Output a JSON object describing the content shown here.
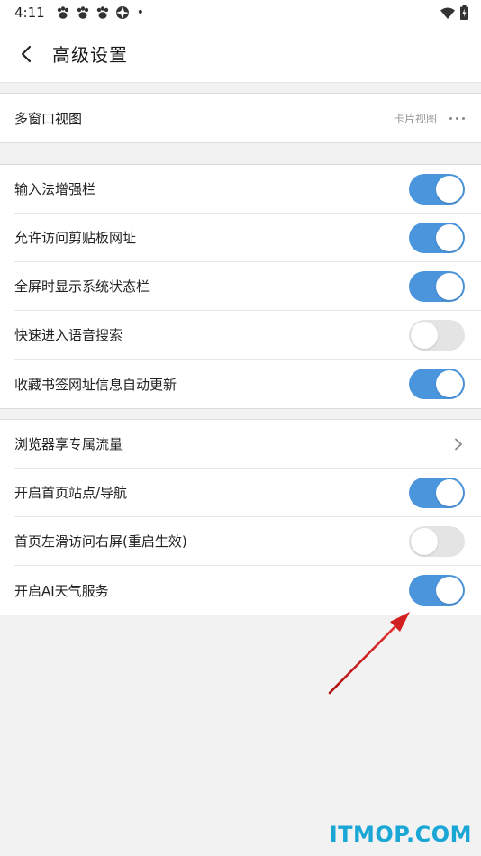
{
  "status": {
    "time": "4:11",
    "dot": "•",
    "icons": [
      "paw-icon",
      "paw-icon",
      "paw-icon",
      "aperture-icon"
    ],
    "right_icons": [
      "wifi-icon",
      "battery-charging-icon"
    ]
  },
  "header": {
    "back_icon": "chevron-left-icon",
    "title": "高级设置"
  },
  "sections": [
    {
      "rows": [
        {
          "label": "多窗口视图",
          "value": "卡片视图",
          "control": "more"
        }
      ]
    },
    {
      "rows": [
        {
          "label": "输入法增强栏",
          "control": "toggle",
          "on": true
        },
        {
          "label": "允许访问剪贴板网址",
          "control": "toggle",
          "on": true
        },
        {
          "label": "全屏时显示系统状态栏",
          "control": "toggle",
          "on": true
        },
        {
          "label": "快速进入语音搜索",
          "control": "toggle",
          "on": false
        },
        {
          "label": "收藏书签网址信息自动更新",
          "control": "toggle",
          "on": true
        }
      ]
    },
    {
      "rows": [
        {
          "label": "浏览器享专属流量",
          "control": "chevron"
        },
        {
          "label": "开启首页站点/导航",
          "control": "toggle",
          "on": true
        },
        {
          "label": "首页左滑访问右屏(重启生效)",
          "control": "toggle",
          "on": false
        },
        {
          "label": "开启AI天气服务",
          "control": "toggle",
          "on": true
        }
      ]
    }
  ],
  "colors": {
    "toggle_on": "#4b95dc",
    "toggle_off": "#e4e4e4",
    "arrow": "#d21f1f",
    "watermark": "#1aa7d6"
  },
  "watermark": "ITMOP.COM"
}
